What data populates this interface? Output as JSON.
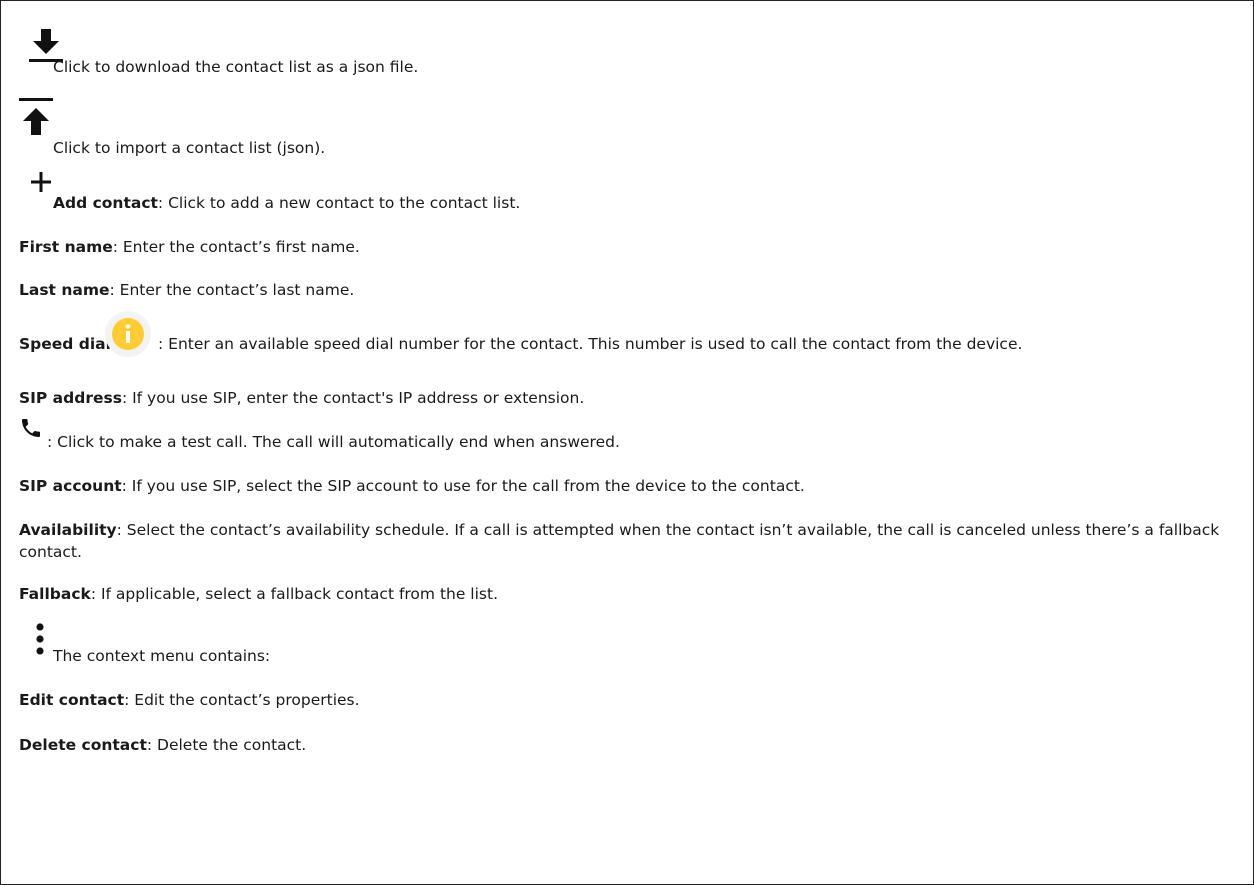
{
  "icons": {
    "download": "download-icon",
    "upload": "upload-icon",
    "add": "plus-icon",
    "info": "info-icon",
    "phone": "phone-icon",
    "menu": "more-vertical-icon"
  },
  "colors": {
    "info_icon": "#FFCC33",
    "text": "#1a1a1a"
  },
  "items": {
    "download": {
      "text": "Click to download the contact list as a json file."
    },
    "import": {
      "text": "Click to import a contact list (json)."
    },
    "add_contact": {
      "label": "Add contact",
      "text": ": Click to add a new contact to the contact list."
    },
    "first_name": {
      "label": "First name",
      "text": ": Enter the contact’s first name."
    },
    "last_name": {
      "label": "Last name",
      "text": ": Enter the contact’s last name."
    },
    "speed_dial": {
      "label": "Speed dial",
      "text": ": Enter an available speed dial number for the contact. This number is used to call the contact from the device."
    },
    "sip_address": {
      "label": "SIP address",
      "text": ": If you use SIP, enter the contact's IP address or extension."
    },
    "test_call": {
      "text": ": Click to make a test call. The call will automatically end when answered."
    },
    "sip_account": {
      "label": "SIP account",
      "text": ": If you use SIP, select the SIP account to use for the call from the device to the contact."
    },
    "availability": {
      "label": "Availability",
      "text": ": Select the contact’s availability schedule. If a call is attempted when the contact isn’t available, the call is canceled unless there’s a fallback contact."
    },
    "fallback": {
      "label": "Fallback",
      "text": ": If applicable, select a fallback contact from the list."
    },
    "context_menu": {
      "text": "The context menu contains:"
    },
    "edit_contact": {
      "label": "Edit contact",
      "text": ": Edit the contact’s properties."
    },
    "delete_contact": {
      "label": "Delete contact",
      "text": ": Delete the contact."
    }
  }
}
